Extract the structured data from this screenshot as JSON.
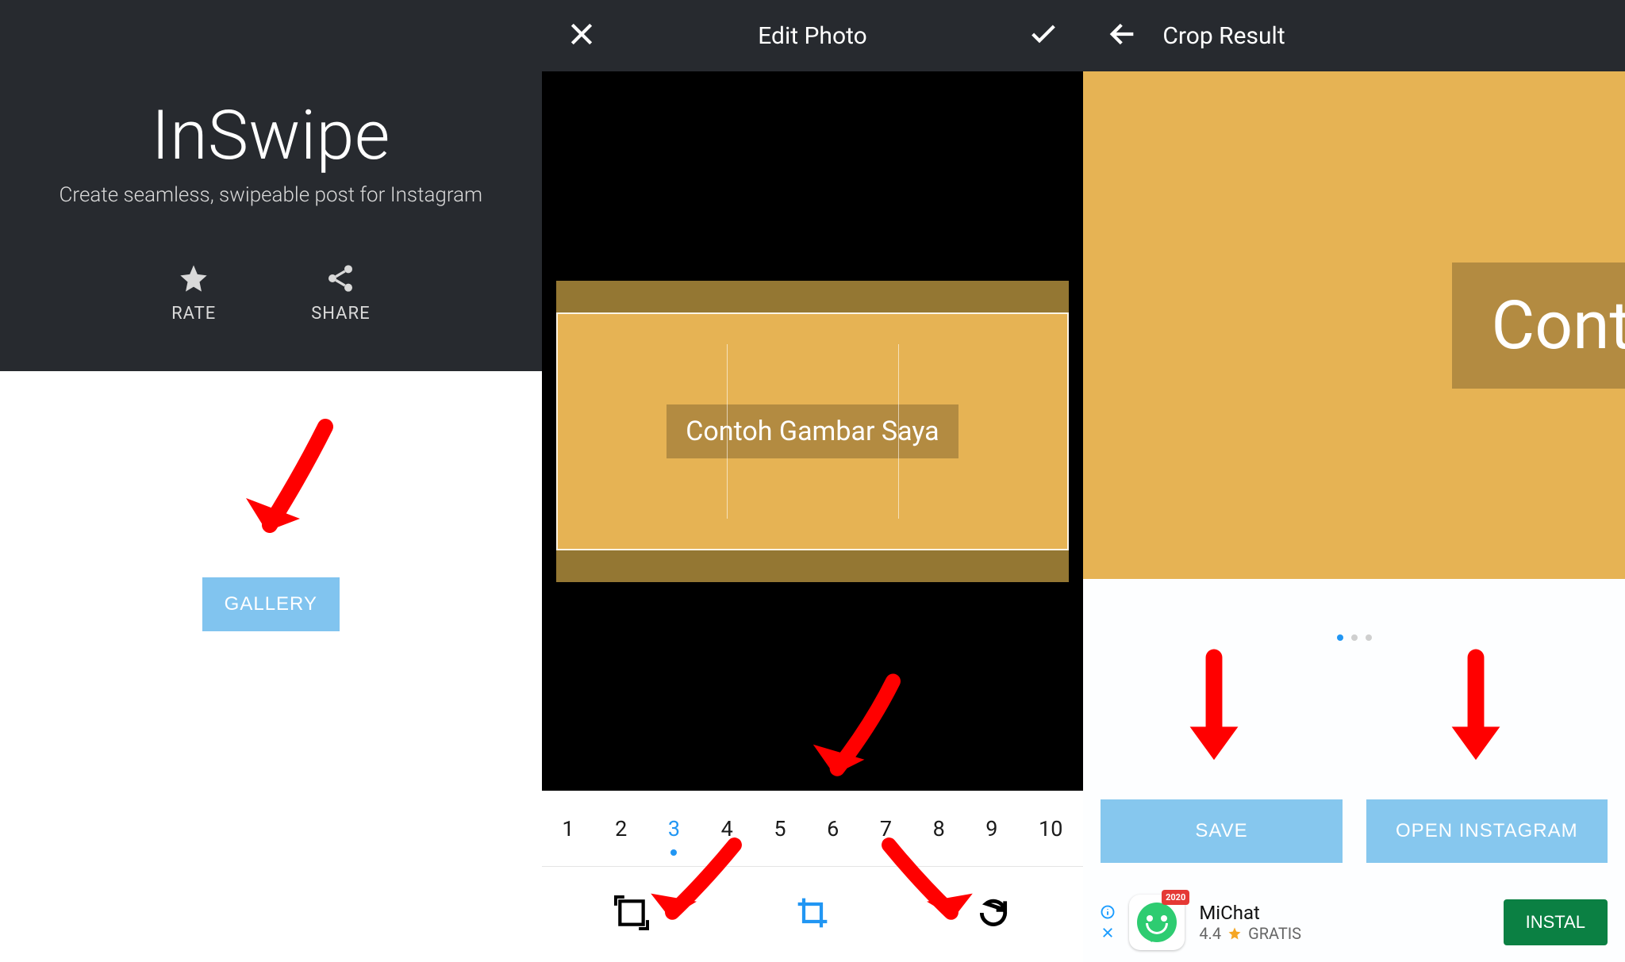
{
  "screen1": {
    "app_name": "InSwipe",
    "tagline": "Create seamless, swipeable post for Instagram",
    "rate_label": "RATE",
    "share_label": "SHARE",
    "gallery_button": "GALLERY"
  },
  "screen2": {
    "title": "Edit Photo",
    "sample_text": "Contoh Gambar Saya",
    "split_options": [
      "1",
      "2",
      "3",
      "4",
      "5",
      "6",
      "7",
      "8",
      "9",
      "10"
    ],
    "split_selected_index": 2
  },
  "screen3": {
    "title": "Crop Result",
    "preview_text_partial": "Cont",
    "save_button": "SAVE",
    "open_ig_button": "OPEN INSTAGRAM",
    "ad": {
      "title": "MiChat",
      "rating": "4.4",
      "price": "GRATIS",
      "install": "INSTAL",
      "badge": "2020"
    }
  }
}
